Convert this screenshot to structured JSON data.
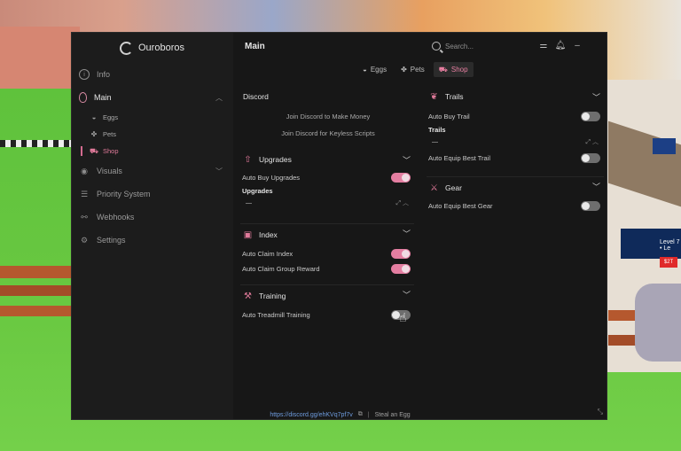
{
  "brand": {
    "name": "Ouroboros"
  },
  "header": {
    "title": "Main",
    "search_placeholder": "Search..."
  },
  "sidebar": {
    "items": [
      {
        "label": "Info"
      },
      {
        "label": "Main"
      },
      {
        "label": "Visuals"
      },
      {
        "label": "Priority System"
      },
      {
        "label": "Webhooks"
      },
      {
        "label": "Settings"
      }
    ],
    "sub_items": [
      {
        "label": "Eggs"
      },
      {
        "label": "Pets"
      },
      {
        "label": "Shop"
      }
    ]
  },
  "tabs": [
    {
      "label": "Eggs"
    },
    {
      "label": "Pets"
    },
    {
      "label": "Shop"
    }
  ],
  "left": {
    "discord": {
      "title": "Discord",
      "link1": "Join Discord to Make Money",
      "link2": "Join Discord for Keyless Scripts"
    },
    "upgrades": {
      "title": "Upgrades",
      "auto_buy": "Auto Buy Upgrades",
      "dropdown_label": "Upgrades",
      "dropdown_value": "—"
    },
    "index": {
      "title": "Index",
      "auto_claim_index": "Auto Claim Index",
      "auto_claim_group": "Auto Claim Group Reward"
    },
    "training": {
      "title": "Training",
      "auto_treadmill": "Auto Treadmill Training"
    }
  },
  "right": {
    "trails": {
      "title": "Trails",
      "auto_buy": "Auto Buy Trail",
      "dropdown_label": "Trails",
      "dropdown_value": "—",
      "auto_equip": "Auto Equip Best Trail"
    },
    "gear": {
      "title": "Gear",
      "auto_equip": "Auto Equip Best Gear"
    }
  },
  "toggles": {
    "auto_buy_upgrades": true,
    "auto_claim_index": true,
    "auto_claim_group": true,
    "auto_treadmill": false,
    "auto_buy_trail": false,
    "auto_equip_trail": false,
    "auto_equip_gear": false
  },
  "footer": {
    "link": "https://discord.gg/ehKVq7pf7v",
    "separator": "|",
    "game": "Steal an Egg"
  },
  "background": {
    "npc_label": "Level 7 • Le",
    "npc_tag": "$2T"
  },
  "colors": {
    "accent": "#e47ea1",
    "panel": "#171717",
    "sidebar": "#1c1c1c"
  }
}
